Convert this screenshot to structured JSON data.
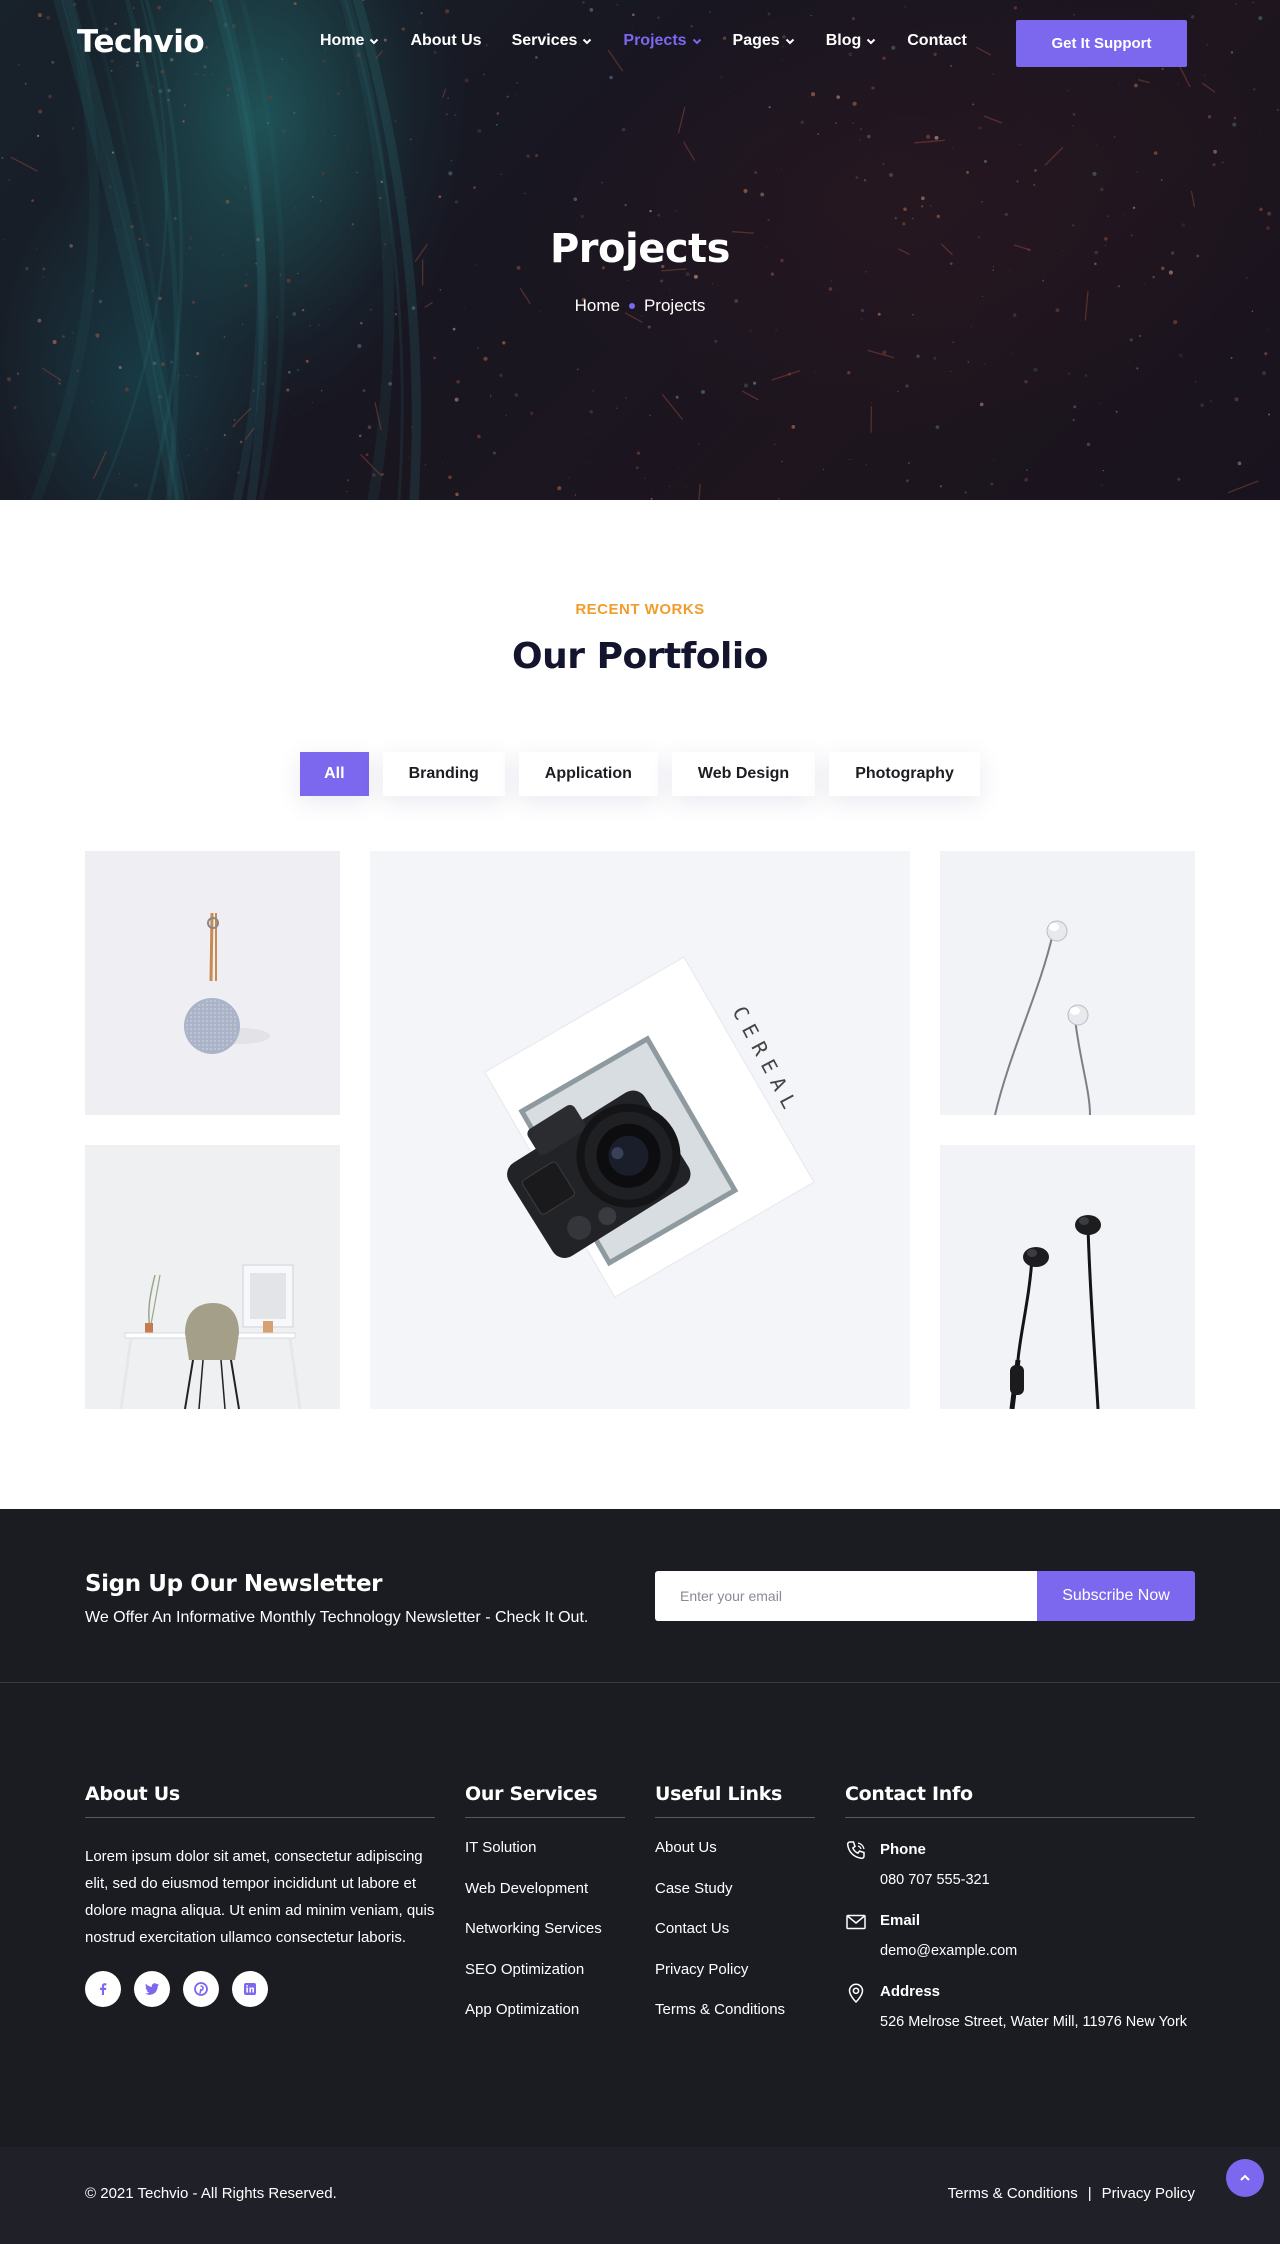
{
  "header": {
    "logo": "Techvio",
    "nav": [
      {
        "label": "Home",
        "has_dropdown": true,
        "active": false
      },
      {
        "label": "About Us",
        "has_dropdown": false,
        "active": false
      },
      {
        "label": "Services",
        "has_dropdown": true,
        "active": false
      },
      {
        "label": "Projects",
        "has_dropdown": true,
        "active": true
      },
      {
        "label": "Pages",
        "has_dropdown": true,
        "active": false
      },
      {
        "label": "Blog",
        "has_dropdown": true,
        "active": false
      },
      {
        "label": "Contact",
        "has_dropdown": false,
        "active": false
      }
    ],
    "cta_label": "Get It Support"
  },
  "hero": {
    "title": "Projects",
    "breadcrumb": [
      "Home",
      "Projects"
    ]
  },
  "portfolio": {
    "eyebrow": "RECENT WORKS",
    "title": "Our Portfolio",
    "filters": [
      {
        "label": "All",
        "active": true
      },
      {
        "label": "Branding",
        "active": false
      },
      {
        "label": "Application",
        "active": false
      },
      {
        "label": "Web Design",
        "active": false
      },
      {
        "label": "Photography",
        "active": false
      }
    ],
    "items": [
      {
        "subject": "speaker-image"
      },
      {
        "subject": "camera-image"
      },
      {
        "subject": "earphones-white-image"
      },
      {
        "subject": "desk-chair-image"
      },
      {
        "subject": "earphones-black-image"
      }
    ],
    "camera_book_text": "CEREAL"
  },
  "newsletter": {
    "title": "Sign Up Our Newsletter",
    "subtitle": "We Offer An Informative Monthly Technology Newsletter - Check It Out.",
    "input_placeholder": "Enter your email",
    "button_label": "Subscribe Now"
  },
  "footer": {
    "about": {
      "title": "About Us",
      "text": "Lorem ipsum dolor sit amet, consectetur adipiscing elit, sed do eiusmod tempor incididunt ut labore et dolore magna aliqua. Ut enim ad minim veniam, quis nostrud exercitation ullamco consectetur laboris.",
      "socials": [
        "facebook-icon",
        "twitter-icon",
        "pinterest-icon",
        "linkedin-icon"
      ]
    },
    "services": {
      "title": "Our Services",
      "links": [
        "IT Solution",
        "Web Development",
        "Networking Services",
        "SEO Optimization",
        "App Optimization"
      ]
    },
    "useful": {
      "title": "Useful Links",
      "links": [
        "About Us",
        "Case Study",
        "Contact Us",
        "Privacy Policy",
        "Terms & Conditions"
      ]
    },
    "contact": {
      "title": "Contact Info",
      "items": [
        {
          "icon": "phone-icon",
          "label": "Phone",
          "value": "080 707 555-321"
        },
        {
          "icon": "envelope-icon",
          "label": "Email",
          "value": "demo@example.com"
        },
        {
          "icon": "map-pin-icon",
          "label": "Address",
          "value": "526 Melrose Street, Water Mill, 11976 New York"
        }
      ]
    },
    "copyright": "2021 Techvio - All Rights Reserved.",
    "bottom_links": [
      "Terms & Conditions",
      "Privacy Policy"
    ]
  },
  "colors": {
    "accent": "#7b68ee",
    "eyebrow": "#f29d2b",
    "dark_bg": "#1b1c22",
    "copyright_bg": "#202029",
    "title_navy": "#13152e"
  }
}
